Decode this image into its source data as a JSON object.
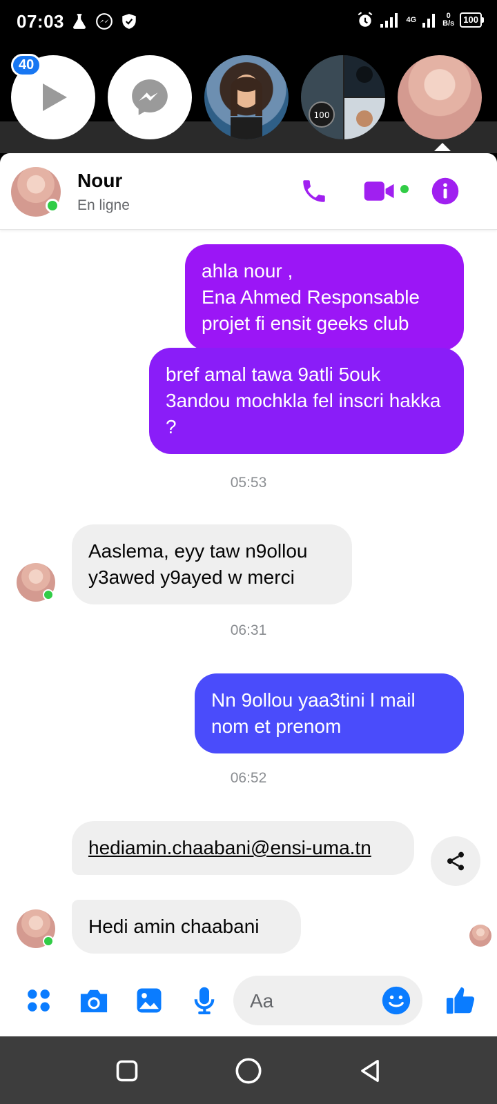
{
  "status_bar": {
    "time": "07:03",
    "network": "4G",
    "net_speed": "0",
    "net_unit": "B/s",
    "battery": "100"
  },
  "chat_heads": {
    "badge_count": "40"
  },
  "conversation": {
    "contact_name": "Nour",
    "contact_status": "En ligne"
  },
  "messages": [
    {
      "direction": "outgoing",
      "text": "ahla nour ,\nEna Ahmed Responsable projet fi ensit geeks club",
      "color": "#9b16f6"
    },
    {
      "direction": "outgoing",
      "text": "bref amal tawa 9atli 5ouk 3andou mochkla fel inscri hakka ?",
      "color": "#8a1df8"
    },
    {
      "timestamp": "05:53"
    },
    {
      "direction": "incoming",
      "text": "Aaslema, eyy taw n9ollou y3awed y9ayed w merci"
    },
    {
      "timestamp": "06:31"
    },
    {
      "direction": "outgoing",
      "text": "Nn 9ollou yaa3tini l mail nom et prenom",
      "color": "#4a4cfb"
    },
    {
      "timestamp": "06:52"
    },
    {
      "direction": "incoming",
      "text": "hediamin.chaabani@ensi-uma.tn",
      "link": true
    },
    {
      "direction": "incoming",
      "text": "Hedi amin chaabani"
    }
  ],
  "composer": {
    "placeholder": "Aa"
  },
  "colors": {
    "accent": "#a020f0",
    "online": "#31cc46",
    "messenger_blue": "#0a7cff"
  },
  "icons": [
    "play-icon",
    "messenger-icon",
    "phone-icon",
    "video-icon",
    "info-icon",
    "share-icon",
    "grid-icon",
    "camera-icon",
    "gallery-icon",
    "microphone-icon",
    "emoji-icon",
    "thumbs-up-icon",
    "square-nav-icon",
    "circle-nav-icon",
    "back-nav-icon"
  ]
}
